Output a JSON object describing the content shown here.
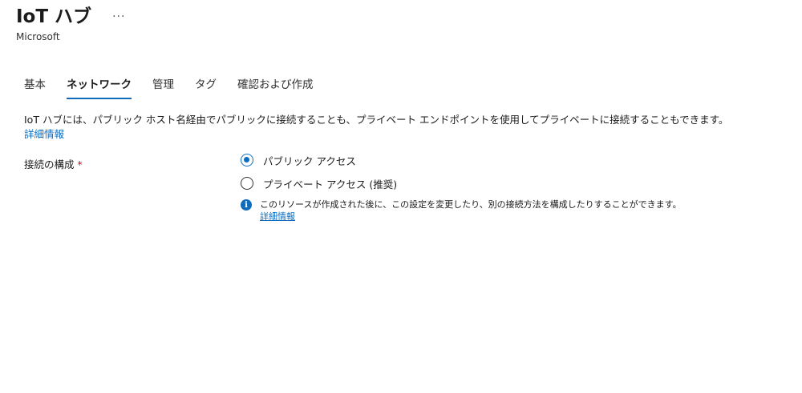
{
  "header": {
    "title": "IoT ハブ",
    "more_label": "···",
    "subtitle": "Microsoft"
  },
  "tabs": [
    {
      "label": "基本",
      "active": false
    },
    {
      "label": "ネットワーク",
      "active": true
    },
    {
      "label": "管理",
      "active": false
    },
    {
      "label": "タグ",
      "active": false
    },
    {
      "label": "確認および作成",
      "active": false
    }
  ],
  "description": {
    "text": "IoT ハブには、パブリック ホスト名経由でパブリックに接続することも、プライベート エンドポイントを使用してプライベートに接続することもできます。",
    "link": "詳細情報"
  },
  "connection": {
    "label": "接続の構成",
    "required_mark": "*",
    "options": [
      {
        "label": "パブリック アクセス",
        "selected": true
      },
      {
        "label": "プライベート アクセス (推奨)",
        "selected": false
      }
    ],
    "info_text": "このリソースが作成された後に、この設定を変更したり、別の接続方法を構成したりすることができます。",
    "info_link": "詳細情報"
  },
  "colors": {
    "accent": "#0f6cbd",
    "required": "#c50f1f"
  },
  "icons": {
    "info": "info-icon",
    "more": "ellipsis-icon"
  }
}
